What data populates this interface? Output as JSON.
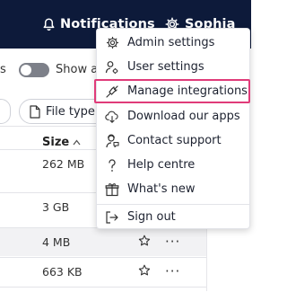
{
  "topbar": {
    "notifications_label": "Notifications",
    "user_name": "Sophia"
  },
  "toolbar": {
    "truncated_left": "s",
    "toggle_label": "Show a"
  },
  "filter": {
    "file_type_label": "File type"
  },
  "table": {
    "size_header": "Size",
    "rows": [
      {
        "size": "262 MB"
      },
      {
        "size": "3 GB"
      },
      {
        "size": "4 MB"
      },
      {
        "size": "663 KB"
      }
    ],
    "more_glyph": "···"
  },
  "menu": {
    "items": [
      {
        "label": "Admin settings",
        "icon": "gear-icon"
      },
      {
        "label": "User settings",
        "icon": "user-gear-icon"
      },
      {
        "label": "Manage integrations",
        "icon": "plug-icon",
        "highlighted": true
      },
      {
        "label": "Download our apps",
        "icon": "cloud-download-icon"
      },
      {
        "label": "Contact support",
        "icon": "support-icon"
      },
      {
        "label": "Help centre",
        "icon": "question-icon"
      },
      {
        "label": "What's new",
        "icon": "gift-icon"
      },
      {
        "label": "Sign out",
        "icon": "sign-out-icon"
      }
    ]
  },
  "colors": {
    "topbar": "#0d1a3a",
    "highlight": "#e03b79"
  }
}
